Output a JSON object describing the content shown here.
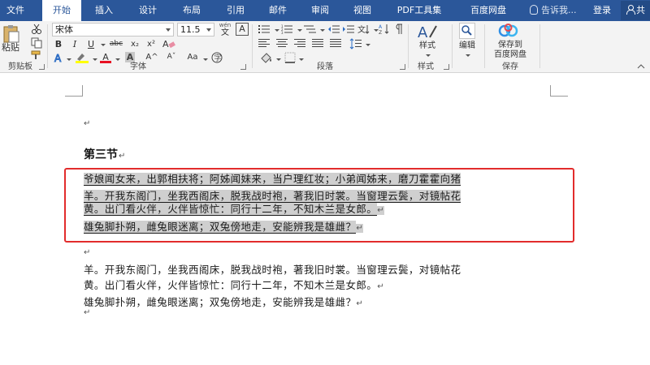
{
  "tabs": [
    {
      "label": "文件",
      "active": false
    },
    {
      "label": "开始",
      "active": true
    },
    {
      "label": "插入",
      "active": false
    },
    {
      "label": "设计",
      "active": false
    },
    {
      "label": "布局",
      "active": false
    },
    {
      "label": "引用",
      "active": false
    },
    {
      "label": "邮件",
      "active": false
    },
    {
      "label": "审阅",
      "active": false
    },
    {
      "label": "视图",
      "active": false
    },
    {
      "label": "PDF工具集",
      "active": false
    },
    {
      "label": "百度网盘",
      "active": false
    }
  ],
  "tell_me": "告诉我...",
  "login": "登录",
  "share": "共",
  "ribbon": {
    "clipboard": {
      "paste": "粘贴",
      "label": "剪贴板"
    },
    "font": {
      "name": "宋体",
      "size": "11.5",
      "wen_label": "wén",
      "wen_char": "文",
      "a_box": "A",
      "bold": "B",
      "italic": "I",
      "underline": "U",
      "strike": "abc",
      "subscript": "x₂",
      "superscript": "x²",
      "font_color_letter": "A",
      "grow": "A^",
      "shrink": "Aˇ",
      "case": "Aa",
      "char_letter": "A",
      "label": "字体"
    },
    "paragraph": {
      "label": "段落"
    },
    "styles": {
      "btn": "样式",
      "label": "样式"
    },
    "editing": {
      "btn": "编辑"
    },
    "save": {
      "line1": "保存到",
      "line2": "百度网盘",
      "label": "保存"
    },
    "colors": {
      "accent": "#2b579a",
      "highlight": "#ffff00",
      "font_color": "#e81123",
      "selection": "#cfcfcf",
      "outline": "#e22c2c"
    }
  },
  "document": {
    "heading": "第三节",
    "selected_lines": [
      "爷娘闻女来，出郭相扶将；阿姊闻妹来，当户理红妆；小弟闻姊来，磨刀霍霍向猪",
      "羊。开我东阁门，坐我西阁床，脱我战时袍，著我旧时裳。当窗理云鬓，对镜帖花",
      "黄。出门看火伴，火伴皆惊忙：同行十二年，不知木兰是女郎。",
      "雄兔脚扑朔，雌兔眼迷离；双兔傍地走，安能辨我是雄雌？"
    ],
    "plain_lines": [
      "羊。开我东阁门，坐我西阁床，脱我战时袍，著我旧时裳。当窗理云鬓，对镜帖花",
      "黄。出门看火伴，火伴皆惊忙：同行十二年，不知木兰是女郎。",
      "雄兔脚扑朔，雌兔眼迷离；双兔傍地走，安能辨我是雄雌？"
    ],
    "para_mark": "↵"
  }
}
